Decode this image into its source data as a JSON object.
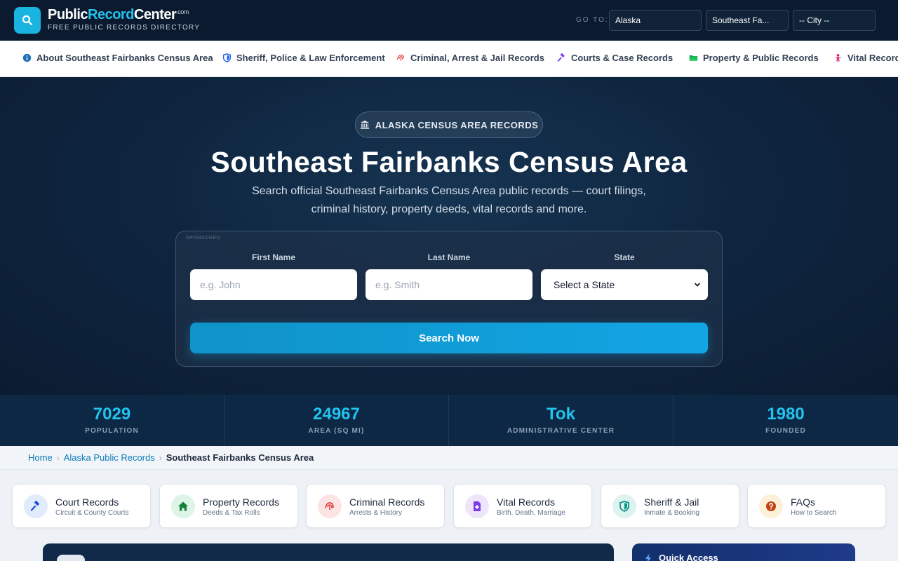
{
  "brand": {
    "name_part1": "Public",
    "name_part2": "Record",
    "name_part3": "Center",
    "tld": ".com",
    "tagline": "FREE PUBLIC RECORDS DIRECTORY",
    "icon": "search-icon"
  },
  "goto": {
    "label": "GO TO:",
    "state": "Alaska",
    "county": "Southeast Fa...",
    "city": "-- City --"
  },
  "nav": {
    "items": [
      {
        "label": "About Southeast Fairbanks Census Area",
        "icon": "info-icon",
        "color": "#1d6fb8"
      },
      {
        "label": "Sheriff, Police & Law Enforcement",
        "icon": "shield-icon",
        "color": "#2563eb"
      },
      {
        "label": "Criminal, Arrest & Jail Records",
        "icon": "fingerprint-icon",
        "color": "#dc2626"
      },
      {
        "label": "Courts & Case Records",
        "icon": "gavel-icon",
        "color": "#7c3aed"
      },
      {
        "label": "Property & Public Records",
        "icon": "folder-icon",
        "color": "#16a34a"
      },
      {
        "label": "Vital Records",
        "icon": "baby-icon",
        "color": "#db2777"
      }
    ]
  },
  "hero": {
    "badge": "ALASKA CENSUS AREA RECORDS",
    "badge_icon": "courthouse-icon",
    "title": "Southeast Fairbanks Census Area",
    "subtitle_line1": "Search official Southeast Fairbanks Census Area public records — court filings,",
    "subtitle_line2": "criminal history, property deeds, vital records and more."
  },
  "search": {
    "sponsored": "SPONSORED",
    "first_name_label": "First Name",
    "first_name_placeholder": "e.g. John",
    "last_name_label": "Last Name",
    "last_name_placeholder": "e.g. Smith",
    "state_label": "State",
    "state_value": "Select a State",
    "button": "Search Now"
  },
  "stats": [
    {
      "value": "7029",
      "label": "POPULATION"
    },
    {
      "value": "24967",
      "label": "AREA (SQ MI)"
    },
    {
      "value": "Tok",
      "label": "ADMINISTRATIVE CENTER"
    },
    {
      "value": "1980",
      "label": "FOUNDED"
    }
  ],
  "breadcrumb": {
    "home": "Home",
    "state": "Alaska Public Records",
    "current": "Southeast Fairbanks Census Area"
  },
  "quick_cards": [
    {
      "title": "Court Records",
      "sub": "Circuit & County Courts",
      "icon": "gavel-icon",
      "bg": "#e0ebfb",
      "color": "#1d4ed8"
    },
    {
      "title": "Property Records",
      "sub": "Deeds & Tax Rolls",
      "icon": "home-icon",
      "bg": "#dcf5e6",
      "color": "#15803d"
    },
    {
      "title": "Criminal Records",
      "sub": "Arrests & History",
      "icon": "fingerprint-icon",
      "bg": "#fde4e4",
      "color": "#dc2626"
    },
    {
      "title": "Vital Records",
      "sub": "Birth, Death, Marriage",
      "icon": "file-plus-icon",
      "bg": "#efe5fb",
      "color": "#7c3aed"
    },
    {
      "title": "Sheriff & Jail",
      "sub": "Inmate & Booking",
      "icon": "shield-icon",
      "bg": "#dcf3ef",
      "color": "#0d9488"
    },
    {
      "title": "FAQs",
      "sub": "How to Search",
      "icon": "question-icon",
      "bg": "#fdf0d9",
      "color": "#c2410c"
    }
  ],
  "quick_access": {
    "title": "Quick Access",
    "icon": "bolt-icon"
  }
}
